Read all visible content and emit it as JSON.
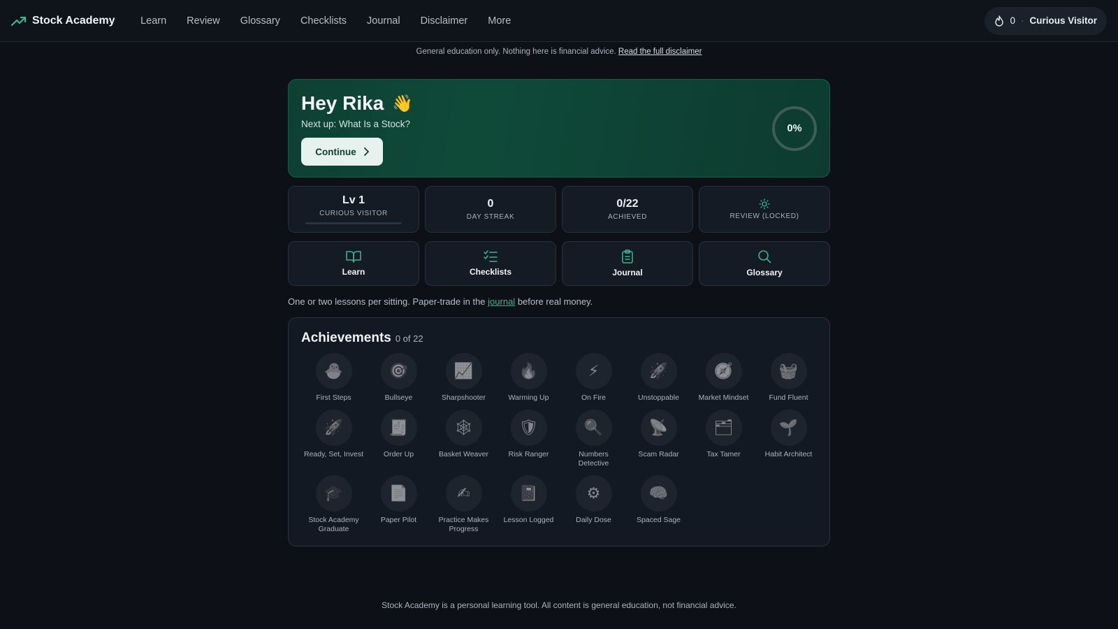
{
  "app": {
    "name": "Stock Academy"
  },
  "nav": {
    "links": [
      "Learn",
      "Review",
      "Glossary",
      "Checklists",
      "Journal",
      "Disclaimer",
      "More"
    ],
    "streak_count": "0",
    "separator": "·",
    "user_level_name": "Curious Visitor"
  },
  "disclaimer": {
    "text": "General education only. Nothing here is financial advice.",
    "link": "Read the full disclaimer"
  },
  "hero": {
    "greeting": "Hey Rika",
    "wave": "👋",
    "next_up": "Next up: What Is a Stock?",
    "continue_label": "Continue",
    "progress_label": "0%",
    "progress_value": 0
  },
  "stats": [
    {
      "big": "Lv 1",
      "small": "Curious Visitor"
    },
    {
      "big": "0",
      "small": "Day Streak"
    },
    {
      "big": "0/22",
      "small": "Achieved"
    },
    {
      "big": "",
      "small": "Review (locked)"
    }
  ],
  "tiles": [
    {
      "label": "Learn",
      "icon": "book-icon"
    },
    {
      "label": "Checklists",
      "icon": "checklist-icon"
    },
    {
      "label": "Journal",
      "icon": "clipboard-icon"
    },
    {
      "label": "Glossary",
      "icon": "search-icon"
    }
  ],
  "tip": {
    "before": "One or two lessons per sitting. Paper-trade in the",
    "link": "journal",
    "after": "before real money."
  },
  "achievements": {
    "title": "Achievements",
    "count": "0 of 22",
    "items": [
      {
        "label": "First Steps",
        "icon": "🐣"
      },
      {
        "label": "Bullseye",
        "icon": "🎯"
      },
      {
        "label": "Sharpshooter",
        "icon": "📈"
      },
      {
        "label": "Warming Up",
        "icon": "🔥"
      },
      {
        "label": "On Fire",
        "icon": "⚡"
      },
      {
        "label": "Unstoppable",
        "icon": "🚀"
      },
      {
        "label": "Market Mindset",
        "icon": "🧭"
      },
      {
        "label": "Fund Fluent",
        "icon": "🧺"
      },
      {
        "label": "Ready, Set, Invest",
        "icon": "🚀"
      },
      {
        "label": "Order Up",
        "icon": "🧾"
      },
      {
        "label": "Basket Weaver",
        "icon": "🕸"
      },
      {
        "label": "Risk Ranger",
        "icon": "🛡"
      },
      {
        "label": "Numbers Detective",
        "icon": "🔍"
      },
      {
        "label": "Scam Radar",
        "icon": "📡"
      },
      {
        "label": "Tax Tamer",
        "icon": "🗂"
      },
      {
        "label": "Habit Architect",
        "icon": "🌱"
      },
      {
        "label": "Stock Academy Graduate",
        "icon": "🎓"
      },
      {
        "label": "Paper Pilot",
        "icon": "📄"
      },
      {
        "label": "Practice Makes Progress",
        "icon": "✍"
      },
      {
        "label": "Lesson Logged",
        "icon": "📓"
      },
      {
        "label": "Daily Dose",
        "icon": "⚙"
      },
      {
        "label": "Spaced Sage",
        "icon": "🧠"
      }
    ]
  },
  "footer": "Stock Academy is a personal learning tool. All content is general education, not financial advice.",
  "colors": {
    "accent": "#3fb58d",
    "hero_bg": "#0f4a39",
    "background": "#0d1117"
  }
}
